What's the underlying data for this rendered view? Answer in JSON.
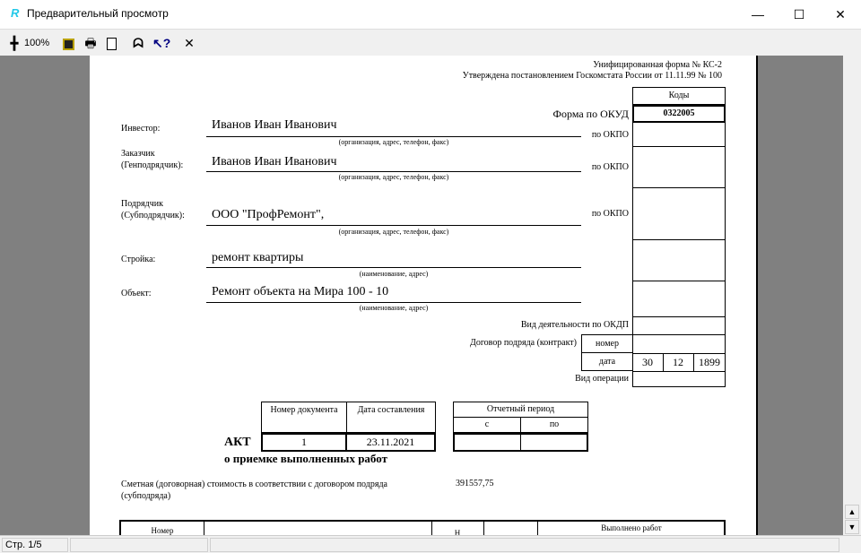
{
  "window": {
    "title": "Предварительный просмотр",
    "minimize": "—",
    "maximize": "☐",
    "close": "✕"
  },
  "toolbar": {
    "zoom_label": "100%"
  },
  "doc": {
    "form_name": "Унифицированная форма № КС-2",
    "approved": "Утверждена постановлением Госкомстата России от 11.11.99 № 100",
    "codes_header": "Коды",
    "okud_label": "Форма по ОКУД",
    "okud_value": "0322005",
    "okpo": "по ОКПО",
    "investor_label": "Инвестор:",
    "investor_value": "Иванов Иван Иванович",
    "customer_label1": "Заказчик",
    "customer_label2": "(Генподрядчик):",
    "customer_value": "Иванов Иван Иванович",
    "contractor_label1": "Подрядчик",
    "contractor_label2": "(Субподрядчик):",
    "contractor_value": "ООО \"ПрофРемонт\",",
    "org_hint": "(организация, адрес, телефон, факс)",
    "site_label": "Стройка:",
    "site_value": "ремонт квартиры",
    "object_label": "Объект:",
    "object_value": "Ремонт объекта на Мира 100 - 10",
    "name_hint": "(наименование, адрес)",
    "okdp": "Вид деятельности по ОКДП",
    "contract": "Договор подряда (контракт)",
    "number": "номер",
    "date": "дата",
    "date_d": "30",
    "date_m": "12",
    "date_y": "1899",
    "operation": "Вид операции",
    "doc_num_h": "Номер документа",
    "doc_date_h": "Дата составления",
    "doc_num": "1",
    "doc_date": "23.11.2021",
    "period_h": "Отчетный период",
    "period_from": "с",
    "period_to": "по",
    "act": "АКТ",
    "act_sub": "о приемке выполненных работ",
    "cost_label": "Сметная (договорная) стоимость в соответствии с договором подряда (субподряда)",
    "cost_value": "391557,75",
    "tbl_num": "Номер",
    "tbl_unit": "Н",
    "tbl_done": "Выполнено работ"
  },
  "status": {
    "page": "Стр. 1/5"
  }
}
